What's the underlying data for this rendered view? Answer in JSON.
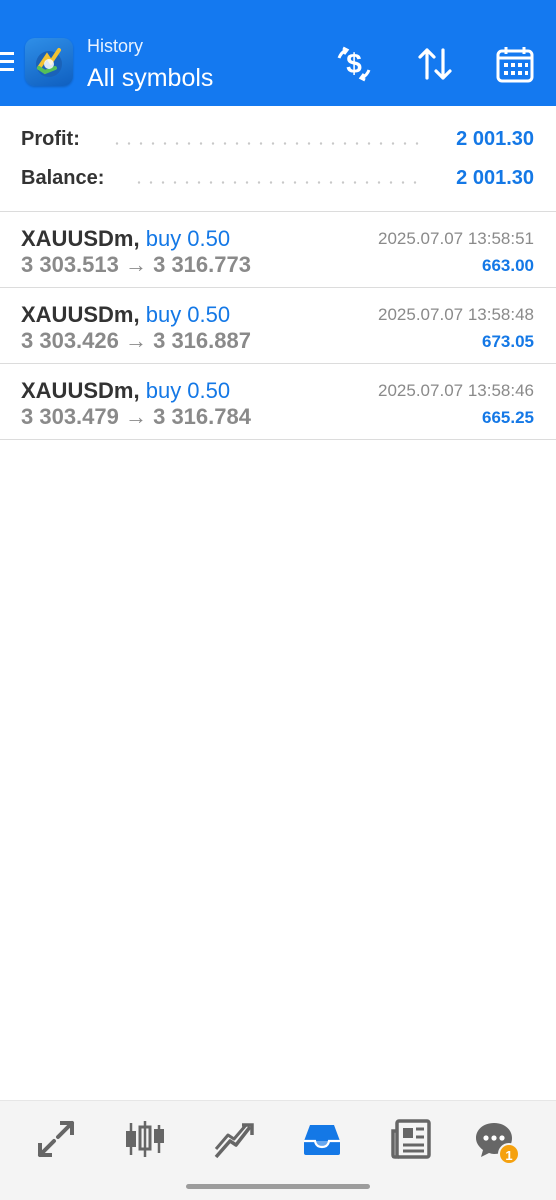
{
  "header": {
    "subtitle": "History",
    "title": "All symbols",
    "background_color": "#1479f0",
    "buttons": [
      {
        "name": "deposit-withdrawal-icon"
      },
      {
        "name": "sort-icon"
      },
      {
        "name": "calendar-icon"
      }
    ]
  },
  "summary": {
    "profit_label": "Profit:",
    "profit_value": "2 001.30",
    "balance_label": "Balance:",
    "balance_value": "2 001.30"
  },
  "deals": [
    {
      "symbol": "XAUUSDm",
      "comma": ",",
      "side": "buy 0.50",
      "prices": "3 303.513 → 3 316.773",
      "time": "2025.07.07 13:58:51",
      "profit": "663.00"
    },
    {
      "symbol": "XAUUSDm",
      "comma": ",",
      "side": "buy 0.50",
      "prices": "3 303.426 → 3 316.887",
      "time": "2025.07.07 13:58:48",
      "profit": "673.05"
    },
    {
      "symbol": "XAUUSDm",
      "comma": ",",
      "side": "buy 0.50",
      "prices": "3 303.479 → 3 316.784",
      "time": "2025.07.07 13:58:46",
      "profit": "665.25"
    }
  ],
  "bottom_nav": {
    "items": [
      {
        "name": "quotes-icon"
      },
      {
        "name": "chart-icon"
      },
      {
        "name": "trade-icon"
      },
      {
        "name": "history-icon",
        "active": true
      },
      {
        "name": "news-icon"
      },
      {
        "name": "messages-icon",
        "badge": "1"
      }
    ],
    "accent_color": "#1478e6",
    "badge_color": "#f5a10f"
  }
}
